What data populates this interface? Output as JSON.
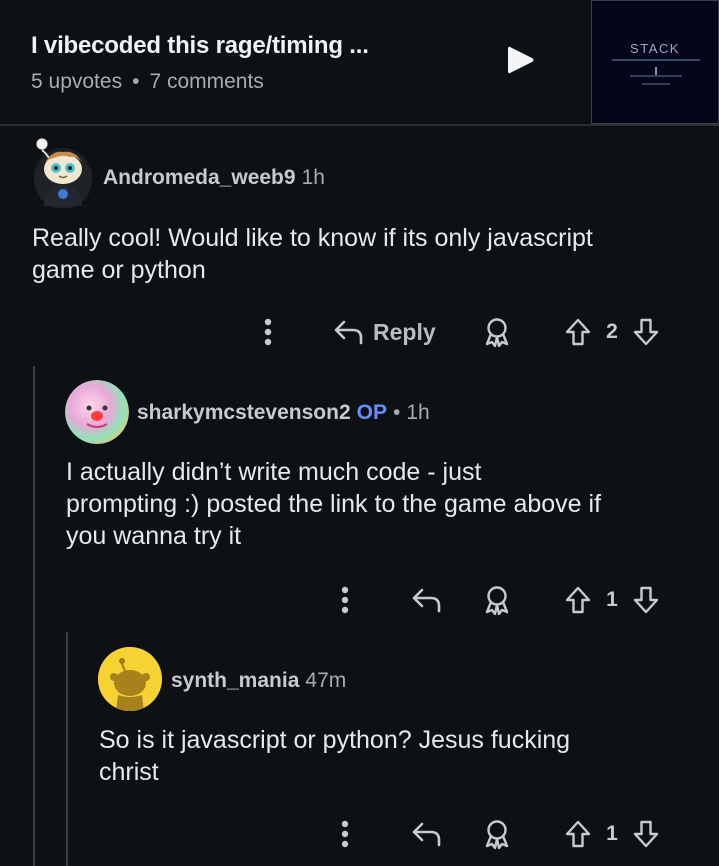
{
  "post": {
    "title": "I vibecoded this rage/timing ...",
    "upvotes": "5 upvotes",
    "separator": "•",
    "comments": "7 comments",
    "thumbnail_text": "STACK"
  },
  "comments": [
    {
      "author": "Andromeda_weeb9",
      "op_badge": "",
      "time": "1h",
      "body_lines": [
        "Really cool! Would like to know if its only javascript",
        "game or python"
      ],
      "reply_label": "Reply",
      "votes": "2"
    },
    {
      "author": "sharkymcstevenson2",
      "op_badge": "OP",
      "separator": "•",
      "time": "1h",
      "body_lines": [
        "I actually didn’t write much code - just",
        "prompting :) posted the link to the game above if",
        "you wanna try it"
      ],
      "votes": "1"
    },
    {
      "author": "synth_mania",
      "op_badge": "",
      "time": "47m",
      "body_lines": [
        "So is it javascript or python? Jesus fucking",
        "christ"
      ],
      "votes": "1"
    }
  ],
  "icons": {
    "more": "more-vertical-icon",
    "reply": "reply-arrow-icon",
    "award": "award-icon",
    "upvote": "upvote-arrow-icon",
    "downvote": "downvote-arrow-icon",
    "play": "play-icon"
  },
  "colors": {
    "background": "#0e1113",
    "op_badge": "#648efc",
    "text": "#e7eaec",
    "muted": "#a4adb3"
  }
}
